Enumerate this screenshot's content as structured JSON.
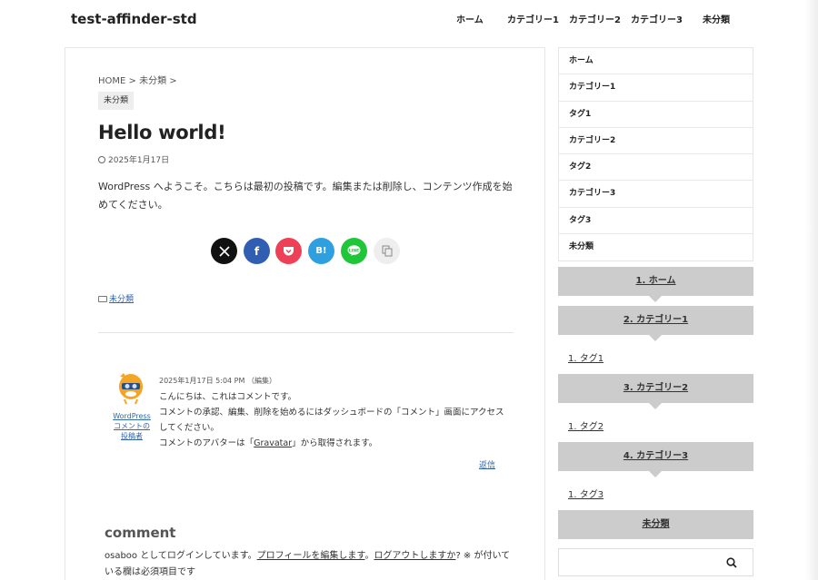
{
  "site": {
    "title": "test-affinder-std"
  },
  "global_nav": [
    {
      "label": "ホーム"
    },
    {
      "label": "カテゴリー1"
    },
    {
      "label": "カテゴリー2"
    },
    {
      "label": "カテゴリー3"
    },
    {
      "label": "未分類"
    }
  ],
  "article": {
    "breadcrumb": "HOME > 未分類 >",
    "category_badge": "未分類",
    "title": "Hello world!",
    "date": "2025年1月17日",
    "body": "WordPress へようこそ。こちらは最初の投稿です。編集または削除し、コンテンツ作成を始めてください。",
    "share_buttons": [
      {
        "name": "x",
        "glyph": "𝕏",
        "color": "#111111"
      },
      {
        "name": "facebook",
        "glyph": "f",
        "color": "#2f5eb3"
      },
      {
        "name": "pocket",
        "glyph": "",
        "color": "#ee4056"
      },
      {
        "name": "hatena",
        "glyph": "B!",
        "color": "#2ea0e0"
      },
      {
        "name": "line",
        "glyph": "",
        "color": "#1fc738"
      },
      {
        "name": "copy",
        "glyph": "",
        "color": "#eeeeee"
      }
    ],
    "category_link": "未分類"
  },
  "comment": {
    "author": "WordPress コメントの投稿者",
    "meta": "2025年1月17日 5:04 PM （編集）",
    "line1": "こんにちは、これはコメントです。",
    "line2": "コメントの承認、編集、削除を始めるにはダッシュボードの「コメント」画面にアクセスしてください。",
    "line3_pre": "コメントのアバターは「",
    "gravatar": "Gravatar",
    "line3_post": "」から取得されます。",
    "reply": "返信"
  },
  "comment_form": {
    "heading": "comment",
    "logged_in_pre": "osaboo としてログインしています。",
    "edit_profile": "プロフィールを編集します",
    "logout": "ログアウトしますか",
    "logged_in_post": "? ※ が付いている欄は必須項目です"
  },
  "sidebar": {
    "menu": [
      {
        "label": "ホーム"
      },
      {
        "label": "カテゴリー1"
      },
      {
        "label": "タグ1"
      },
      {
        "label": "カテゴリー2"
      },
      {
        "label": "タグ2"
      },
      {
        "label": "カテゴリー3"
      },
      {
        "label": "タグ3"
      },
      {
        "label": "未分類"
      }
    ],
    "heads": [
      {
        "label": "1. ホーム"
      },
      {
        "label": "2. カテゴリー1"
      },
      {
        "label": "3. カテゴリー2"
      },
      {
        "label": "4. カテゴリー3"
      },
      {
        "label": "未分類"
      }
    ],
    "links": [
      {
        "label": "1. タグ1"
      },
      {
        "label": "1. タグ2"
      },
      {
        "label": "1. タグ3"
      }
    ]
  },
  "search": {
    "placeholder": ""
  }
}
